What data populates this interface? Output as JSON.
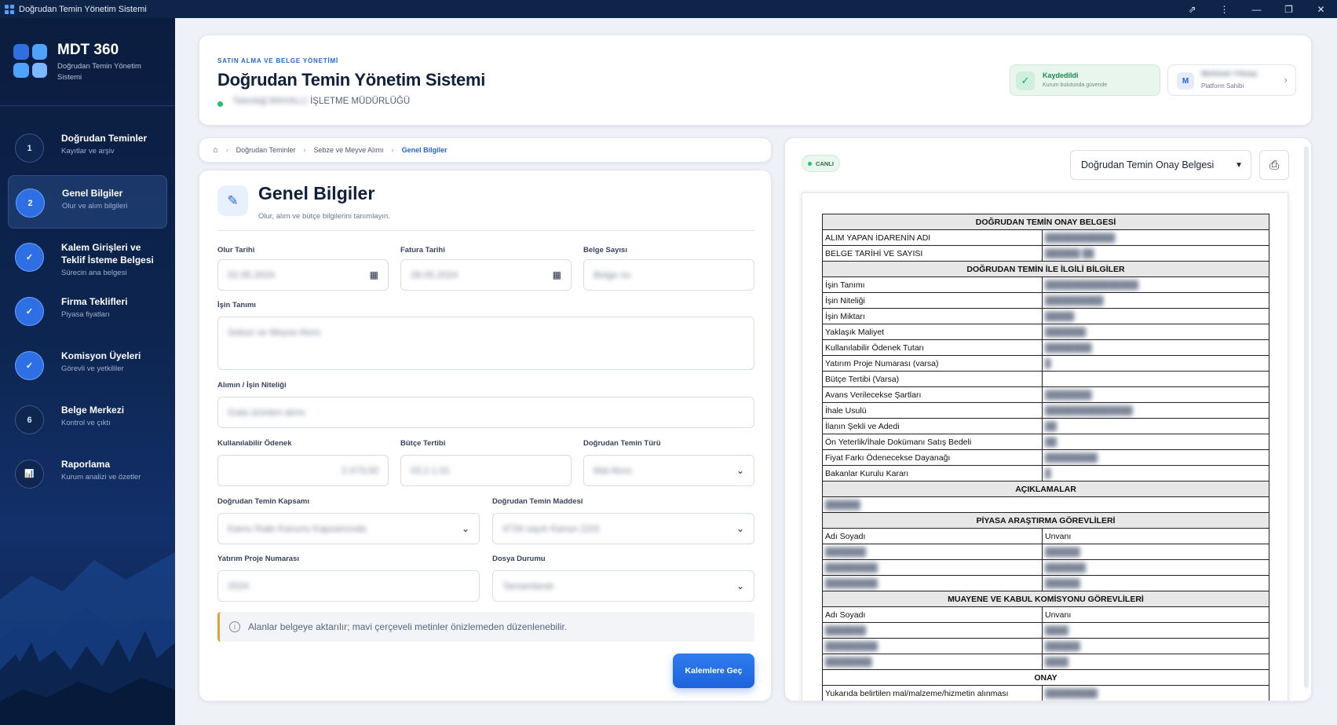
{
  "window": {
    "title": "Doğrudan Temin Yönetim Sistemi",
    "controls": {
      "share": "⇗",
      "more": "⋮",
      "minimize": "—",
      "maximize": "❐",
      "close": "✕"
    }
  },
  "sidebar": {
    "brand": "MDT 360",
    "subtitle": "Doğrudan Temin Yönetim Sistemi",
    "items": [
      {
        "num": "1",
        "label": "Doğrudan Teminler",
        "desc": "Kayıtlar ve arşiv",
        "state": "default"
      },
      {
        "num": "2",
        "label": "Genel Bilgiler",
        "desc": "Olur ve alım bilgileri",
        "state": "current"
      },
      {
        "num": "✓",
        "label": "Kalem Girişleri ve Teklif İsteme Belgesi",
        "desc": "Sürecin ana belgesi",
        "state": "done"
      },
      {
        "num": "✓",
        "label": "Firma Teklifleri",
        "desc": "Piyasa fiyatları",
        "state": "done"
      },
      {
        "num": "✓",
        "label": "Komisyon Üyeleri",
        "desc": "Görevli ve yetkililer",
        "state": "done"
      },
      {
        "num": "6",
        "label": "Belge Merkezi",
        "desc": "Kontrol ve çıktı",
        "state": "default"
      },
      {
        "num": "📊",
        "label": "Raporlama",
        "desc": "Kurum analizi ve özetler",
        "state": "default"
      }
    ]
  },
  "header": {
    "eyebrow": "SATIN ALMA VE BELGE YÖNETİMİ",
    "title": "Doğrudan Temin Yönetim Sistemi",
    "org_blurred": "Tekirdağ MAHALLİ",
    "org_suffix": "İŞLETME MÜDÜRLÜĞÜ",
    "saved_title": "Kaydedildi",
    "saved_sub": "Kurum bulutunda güvende",
    "owner_initial": "M",
    "owner_name": "Mehmet Yılmaz",
    "owner_role": "Platform Sahibi"
  },
  "breadcrumb": {
    "items": [
      "Doğrudan Teminler",
      "Sebze ve Meyve Alımı"
    ],
    "current": "Genel Bilgiler"
  },
  "form": {
    "title": "Genel Bilgiler",
    "subtitle": "Olur, alım ve bütçe bilgilerini tanımlayın.",
    "fields": {
      "olur_tarihi": {
        "label": "Olur Tarihi",
        "value": "02.05.2024"
      },
      "fatura_tarihi": {
        "label": "Fatura Tarihi",
        "value": "28.05.2024"
      },
      "belge_sayisi": {
        "label": "Belge Sayısı",
        "value": "Belge no"
      },
      "isin_tanimi": {
        "label": "İşin Tanımı",
        "value": "Sebze ve Meyve Alımı"
      },
      "isin_niteligi": {
        "label": "Alımın / İşin Niteliği",
        "value": "Gıda ürünleri alımı"
      },
      "odenek": {
        "label": "Kullanılabilir Ödenek",
        "value": "2.473,00"
      },
      "butce": {
        "label": "Bütçe Tertibi",
        "value": "03.2.1.01"
      },
      "temin_turu": {
        "label": "Doğrudan Temin Türü",
        "value": "Mal Alımı"
      },
      "kapsam": {
        "label": "Doğrudan Temin Kapsamı",
        "value": "Kamu İhale Kanunu Kapsamında"
      },
      "madde": {
        "label": "Doğrudan Temin Maddesi",
        "value": "4734 sayılı Kanun 22/d"
      },
      "yatirim": {
        "label": "Yatırım Proje Numarası",
        "value": "2024"
      },
      "dosya": {
        "label": "Dosya Durumu",
        "value": "Tamamlandı"
      }
    },
    "info": "Alanlar belgeye aktarılır; mavi çerçeveli metinler önizlemeden düzenlenebilir.",
    "next_button": "Kalemlere Geç"
  },
  "preview": {
    "badge": "CANLI",
    "doc_select": "Doğrudan Temin Onay Belgesi",
    "table": {
      "title": "DOĞRUDAN TEMİN ONAY BELGESİ",
      "row1": "ALIM YAPAN İDARENİN ADI",
      "row2": "BELGE TARİHİ VE SAYISI",
      "section1": "DOĞRUDAN TEMİN İLE İLGİLİ BİLGİLER",
      "rows": [
        "İşin Tanımı",
        "İşin Niteliği",
        "İşin Miktarı",
        "Yaklaşık Maliyet",
        "Kullanılabilir Ödenek Tutarı",
        "Yatırım Proje Numarası (varsa)",
        "Bütçe Tertibi (Varsa)",
        "Avans Verilecekse Şartları",
        "İhale Usulü",
        "İlanın Şekli ve Adedi",
        "Ön Yeterlik/İhale Dokümanı Satış Bedeli",
        "Fiyat Farkı Ödenecekse Dayanağı",
        "Bakanlar Kurulu Kararı"
      ],
      "section2": "AÇIKLAMALAR",
      "section3": "PİYASA ARAŞTIRMA GÖREVLİLERİ",
      "name_col": "Adı Soyadı",
      "title_col": "Unvanı",
      "section4": "MUAYENE VE KABUL KOMİSYONU GÖREVLİLERİ",
      "section5": "ONAY",
      "last_row": "Yukarıda belirtilen mal/malzeme/hizmetin alınması"
    }
  }
}
